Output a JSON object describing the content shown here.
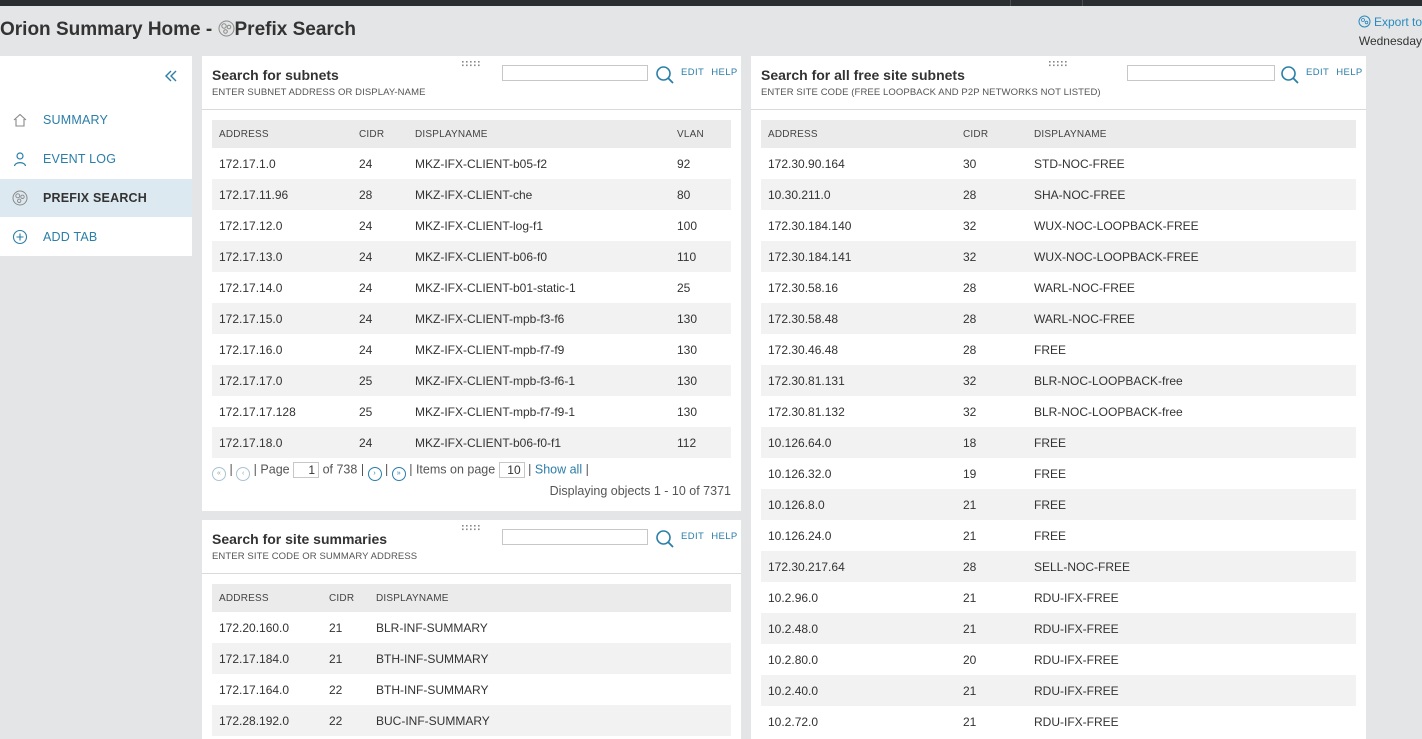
{
  "page": {
    "title_main": "Orion Summary Home - ",
    "title_tab": "Prefix Search",
    "export_label": "Export to",
    "date_label": "Wednesday"
  },
  "sidebar": {
    "items": [
      {
        "label": "SUMMARY",
        "icon": "home-icon"
      },
      {
        "label": "EVENT LOG",
        "icon": "person-icon"
      },
      {
        "label": "PREFIX SEARCH",
        "icon": "globe-icon",
        "active": true
      },
      {
        "label": "ADD TAB",
        "icon": "plus-circle-icon"
      }
    ]
  },
  "subnets": {
    "title": "Search for subnets",
    "subtitle": "ENTER SUBNET ADDRESS OR DISPLAY-NAME",
    "search_value": "",
    "edit_label": "EDIT",
    "help_label": "HELP",
    "columns": [
      "ADDRESS",
      "CIDR",
      "DISPLAYNAME",
      "VLAN"
    ],
    "rows": [
      [
        "172.17.1.0",
        "24",
        "MKZ-IFX-CLIENT-b05-f2",
        "92"
      ],
      [
        "172.17.11.96",
        "28",
        "MKZ-IFX-CLIENT-che",
        "80"
      ],
      [
        "172.17.12.0",
        "24",
        "MKZ-IFX-CLIENT-log-f1",
        "100"
      ],
      [
        "172.17.13.0",
        "24",
        "MKZ-IFX-CLIENT-b06-f0",
        "110"
      ],
      [
        "172.17.14.0",
        "24",
        "MKZ-IFX-CLIENT-b01-static-1",
        "25"
      ],
      [
        "172.17.15.0",
        "24",
        "MKZ-IFX-CLIENT-mpb-f3-f6",
        "130"
      ],
      [
        "172.17.16.0",
        "24",
        "MKZ-IFX-CLIENT-mpb-f7-f9",
        "130"
      ],
      [
        "172.17.17.0",
        "25",
        "MKZ-IFX-CLIENT-mpb-f3-f6-1",
        "130"
      ],
      [
        "172.17.17.128",
        "25",
        "MKZ-IFX-CLIENT-mpb-f7-f9-1",
        "130"
      ],
      [
        "172.17.18.0",
        "24",
        "MKZ-IFX-CLIENT-b06-f0-f1",
        "112"
      ]
    ],
    "pager": {
      "page_label": "Page",
      "page_value": "1",
      "of_label": "of 738",
      "items_label": "Items on page",
      "items_value": "10",
      "show_all": "Show all",
      "displaying": "Displaying objects 1 - 10 of 7371"
    }
  },
  "summaries": {
    "title": "Search for site summaries",
    "subtitle": "ENTER SITE CODE OR SUMMARY ADDRESS",
    "search_value": "",
    "edit_label": "EDIT",
    "help_label": "HELP",
    "columns": [
      "ADDRESS",
      "CIDR",
      "DISPLAYNAME"
    ],
    "rows": [
      [
        "172.20.160.0",
        "21",
        "BLR-INF-SUMMARY"
      ],
      [
        "172.17.184.0",
        "21",
        "BTH-INF-SUMMARY"
      ],
      [
        "172.17.164.0",
        "22",
        "BTH-INF-SUMMARY"
      ],
      [
        "172.28.192.0",
        "22",
        "BUC-INF-SUMMARY"
      ]
    ]
  },
  "free": {
    "title": "Search for all free site subnets",
    "subtitle": "ENTER SITE CODE (FREE LOOPBACK AND P2P NETWORKS NOT LISTED)",
    "search_value": "",
    "edit_label": "EDIT",
    "help_label": "HELP",
    "columns": [
      "ADDRESS",
      "CIDR",
      "DISPLAYNAME"
    ],
    "rows": [
      [
        "172.30.90.164",
        "30",
        "STD-NOC-FREE"
      ],
      [
        "10.30.211.0",
        "28",
        "SHA-NOC-FREE"
      ],
      [
        "172.30.184.140",
        "32",
        "WUX-NOC-LOOPBACK-FREE"
      ],
      [
        "172.30.184.141",
        "32",
        "WUX-NOC-LOOPBACK-FREE"
      ],
      [
        "172.30.58.16",
        "28",
        "WARL-NOC-FREE"
      ],
      [
        "172.30.58.48",
        "28",
        "WARL-NOC-FREE"
      ],
      [
        "172.30.46.48",
        "28",
        "FREE"
      ],
      [
        "172.30.81.131",
        "32",
        "BLR-NOC-LOOPBACK-free"
      ],
      [
        "172.30.81.132",
        "32",
        "BLR-NOC-LOOPBACK-free"
      ],
      [
        "10.126.64.0",
        "18",
        "FREE"
      ],
      [
        "10.126.32.0",
        "19",
        "FREE"
      ],
      [
        "10.126.8.0",
        "21",
        "FREE"
      ],
      [
        "10.126.24.0",
        "21",
        "FREE"
      ],
      [
        "172.30.217.64",
        "28",
        "SELL-NOC-FREE"
      ],
      [
        "10.2.96.0",
        "21",
        "RDU-IFX-FREE"
      ],
      [
        "10.2.48.0",
        "21",
        "RDU-IFX-FREE"
      ],
      [
        "10.2.80.0",
        "20",
        "RDU-IFX-FREE"
      ],
      [
        "10.2.40.0",
        "21",
        "RDU-IFX-FREE"
      ],
      [
        "10.2.72.0",
        "21",
        "RDU-IFX-FREE"
      ]
    ]
  },
  "colors": {
    "accent": "#2a7ea8",
    "active_nav_bg": "#dde9f0",
    "page_bg": "#e4e5e6",
    "header_bar": "#2b2e31"
  }
}
